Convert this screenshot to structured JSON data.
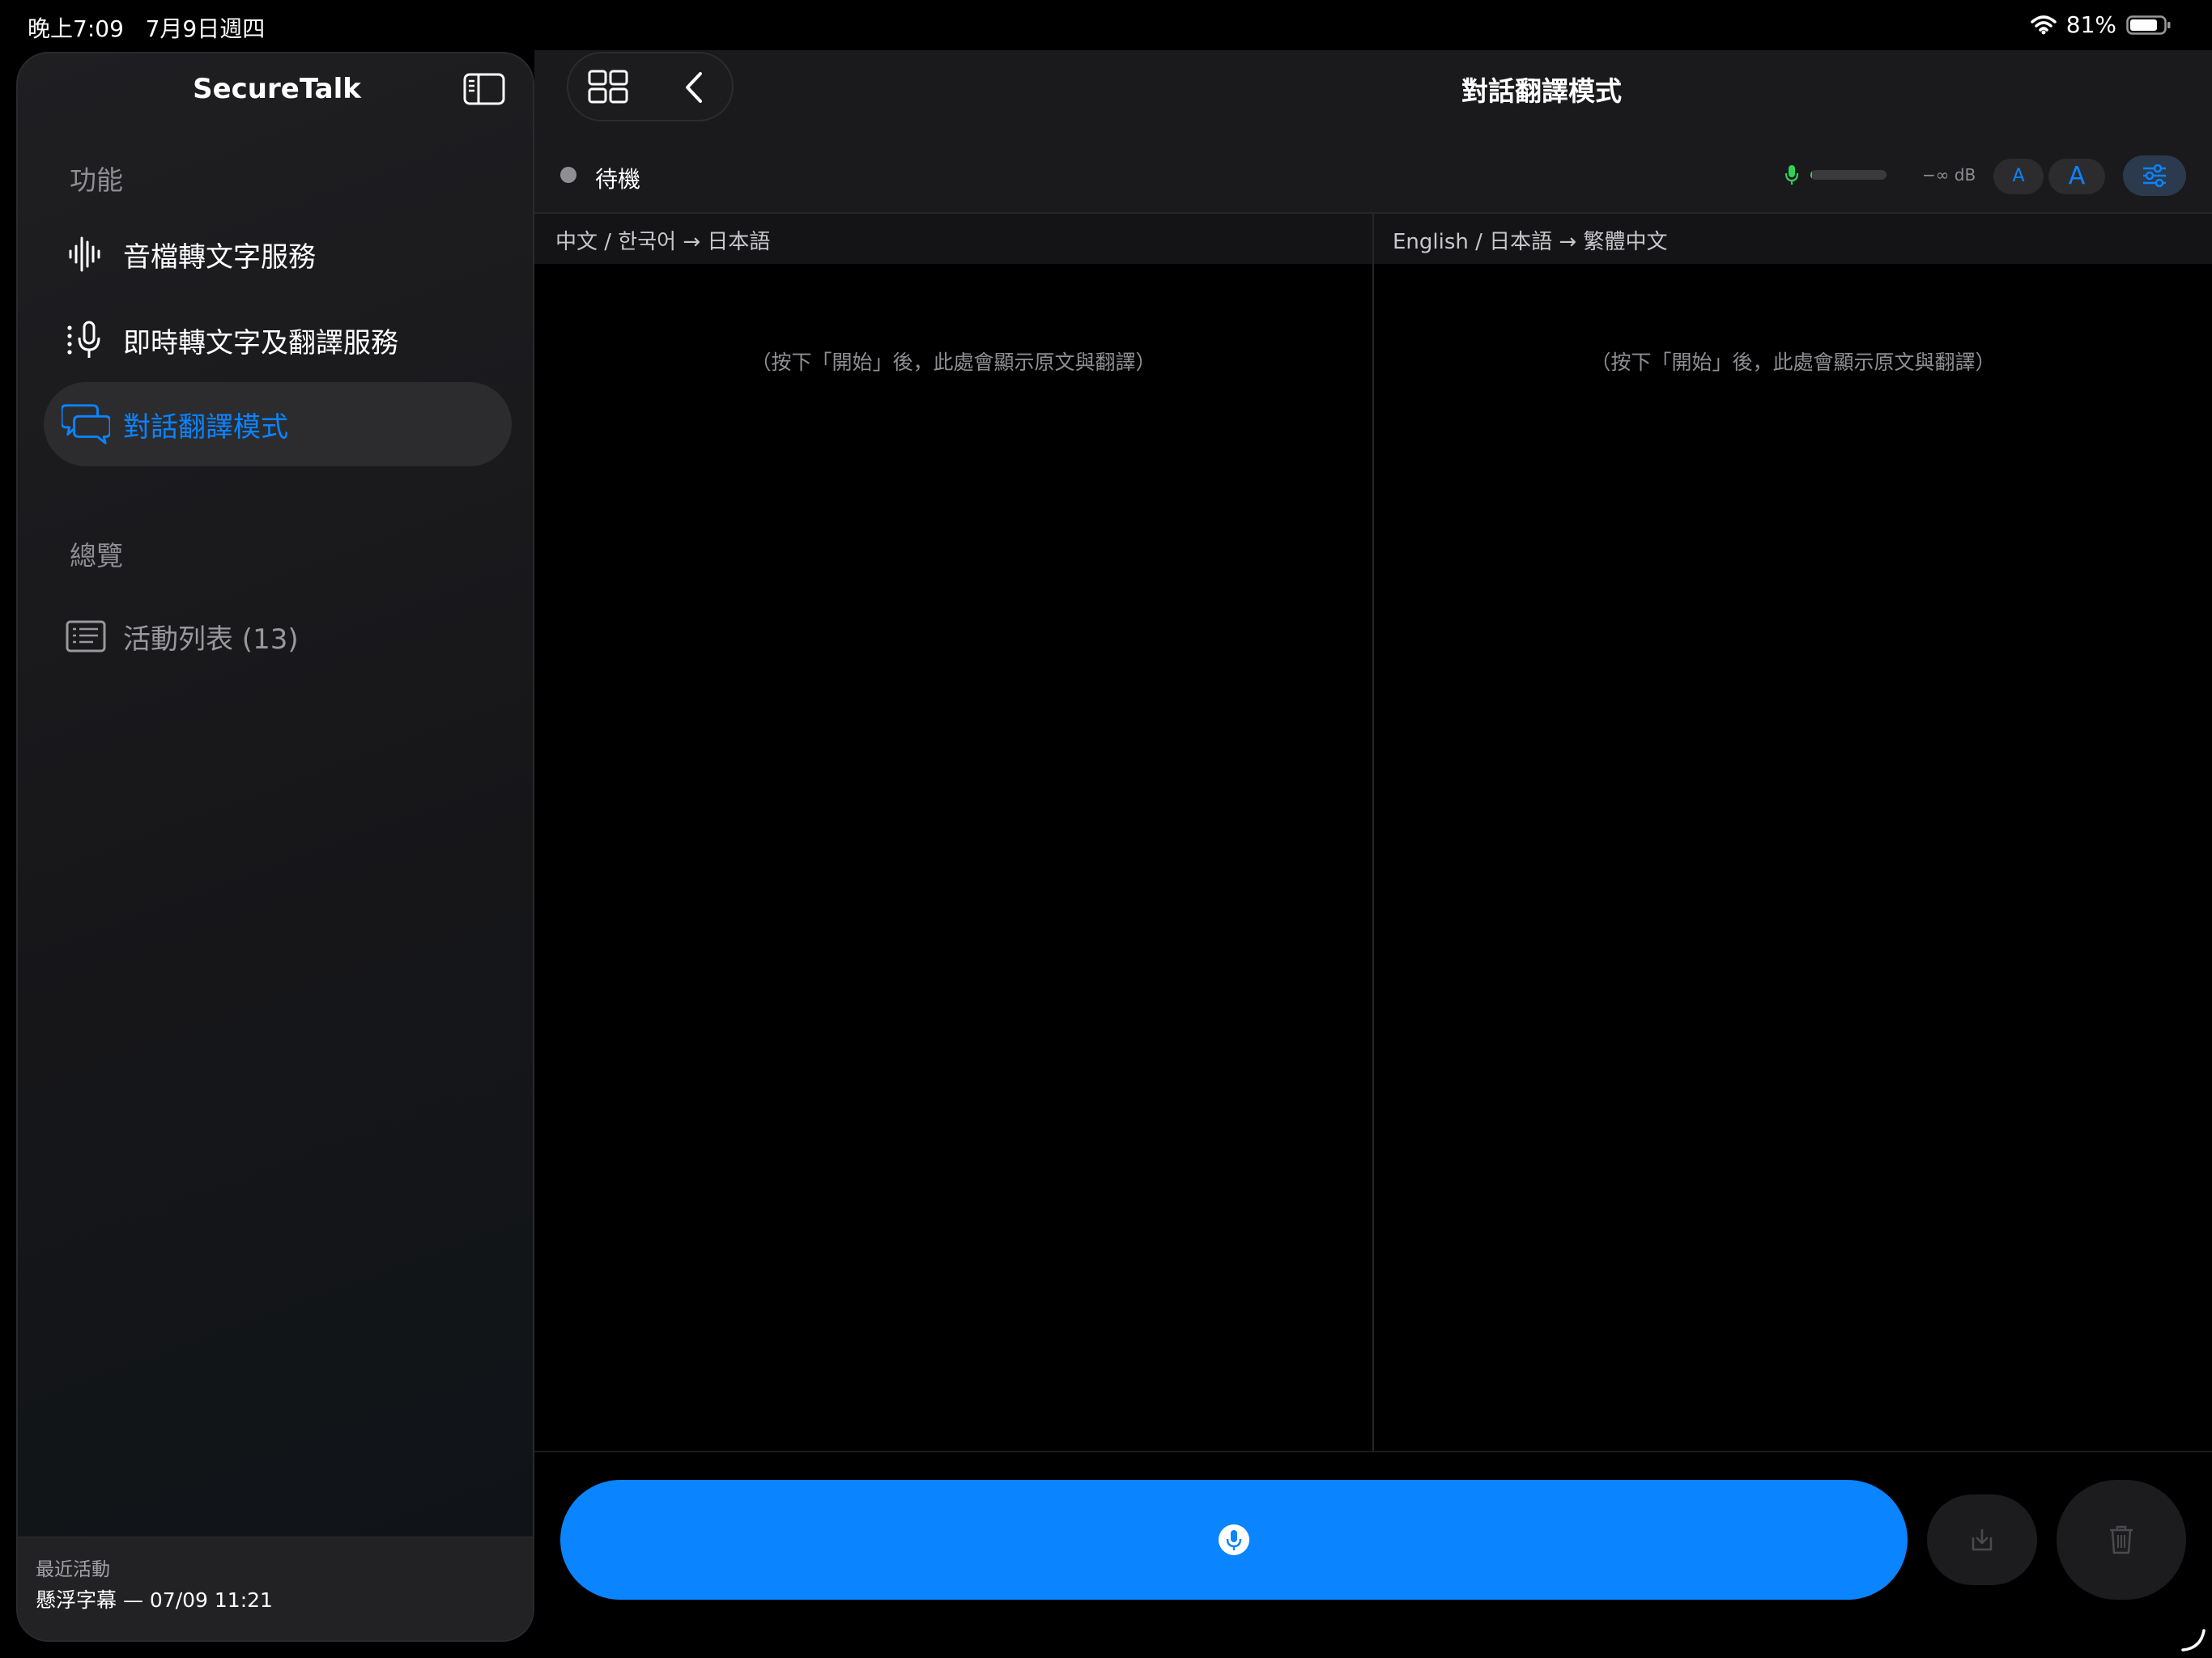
{
  "status_bar": {
    "time": "晚上7:09",
    "date": "7月9日週四",
    "battery": "81%"
  },
  "sidebar": {
    "app_title": "SecureTalk",
    "features_heading": "功能",
    "overview_heading": "總覽",
    "items": [
      {
        "label": "音檔轉文字服務",
        "icon": "waveform-icon"
      },
      {
        "label": "即時轉文字及翻譯服務",
        "icon": "microphone-icon"
      },
      {
        "label": "對話翻譯模式",
        "icon": "chat-bubbles-icon",
        "selected": true
      }
    ],
    "overview_items": [
      {
        "label": "活動列表 (13)",
        "icon": "list-icon"
      }
    ],
    "footer": {
      "label": "最近活動",
      "value": "懸浮字幕 — 07/09 11:21"
    }
  },
  "main": {
    "title": "對話翻譯模式",
    "status": "待機",
    "mic_level": 0.02,
    "db_label": "−∞  dB",
    "font_small": "A",
    "font_large": "A",
    "left_pane": {
      "lang": "中文 / 한국어 → 日本語",
      "placeholder": "（按下「開始」後，此處會顯示原文與翻譯）"
    },
    "right_pane": {
      "lang": "English / 日本語 → 繁體中文",
      "placeholder": "（按下「開始」後，此處會顯示原文與翻譯）"
    }
  },
  "colors": {
    "accent": "#0a84ff",
    "meter": "#30d158",
    "background": "#000000",
    "panel": "#1a1a1c"
  }
}
